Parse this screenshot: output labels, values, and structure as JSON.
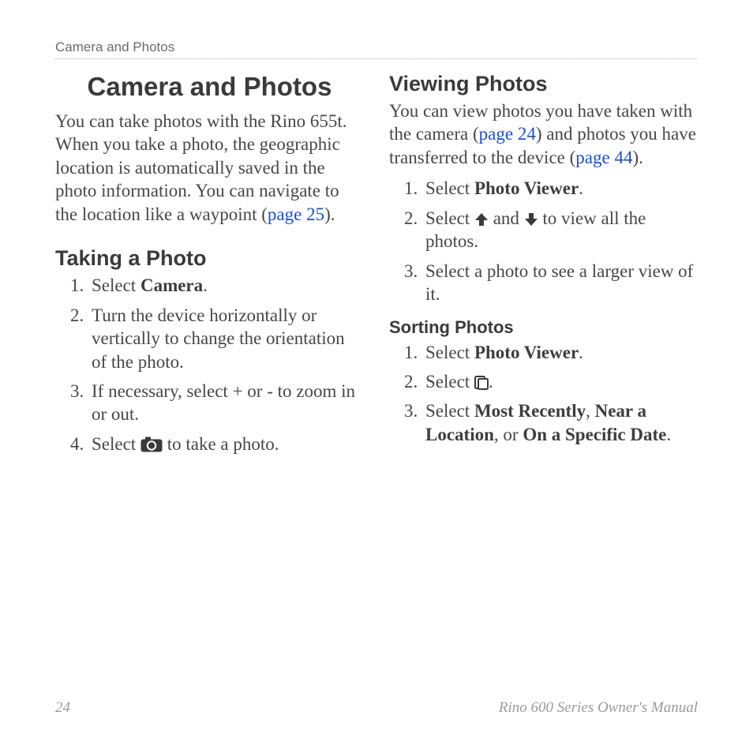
{
  "running_head": "Camera and Photos",
  "footer": {
    "page_number": "24",
    "manual_title": "Rino 600 Series Owner's Manual"
  },
  "left": {
    "chapter_title": "Camera and Photos",
    "intro": {
      "t1": "You can take photos with the Rino 655t. When you take a photo, the geographic location is automatically saved in the photo information. You can navigate to the location like a waypoint (",
      "link": "page 25",
      "t2": ")."
    },
    "taking_photo": {
      "heading": "Taking a Photo",
      "s1a": "Select ",
      "s1b": "Camera",
      "s1c": ".",
      "s2": "Turn the device horizontally or vertically to change the orientation of the photo.",
      "s3": "If necessary, select + or - to zoom in or out.",
      "s4a": "Select ",
      "s4b": " to take a photo."
    }
  },
  "right": {
    "viewing": {
      "heading": "Viewing Photos",
      "intro": {
        "t1": "You can view photos you have taken with the camera (",
        "link1": "page 24",
        "t2": ") and photos you have transferred to the device (",
        "link2": "page 44",
        "t3": ")."
      },
      "s1a": "Select ",
      "s1b": "Photo Viewer",
      "s1c": ".",
      "s2a": "Select ",
      "s2b": " and ",
      "s2c": " to view all the photos.",
      "s3": "Select a photo to see a larger view of it."
    },
    "sorting": {
      "heading": "Sorting Photos",
      "s1a": "Select  ",
      "s1b": "Photo Viewer",
      "s1c": ".",
      "s2a": "Select ",
      "s2b": ".",
      "s3a": "Select ",
      "s3b": "Most Recently",
      "s3c": ", ",
      "s3d": "Near a Location",
      "s3e": ", or ",
      "s3f": "On a Specific Date",
      "s3g": "."
    }
  }
}
